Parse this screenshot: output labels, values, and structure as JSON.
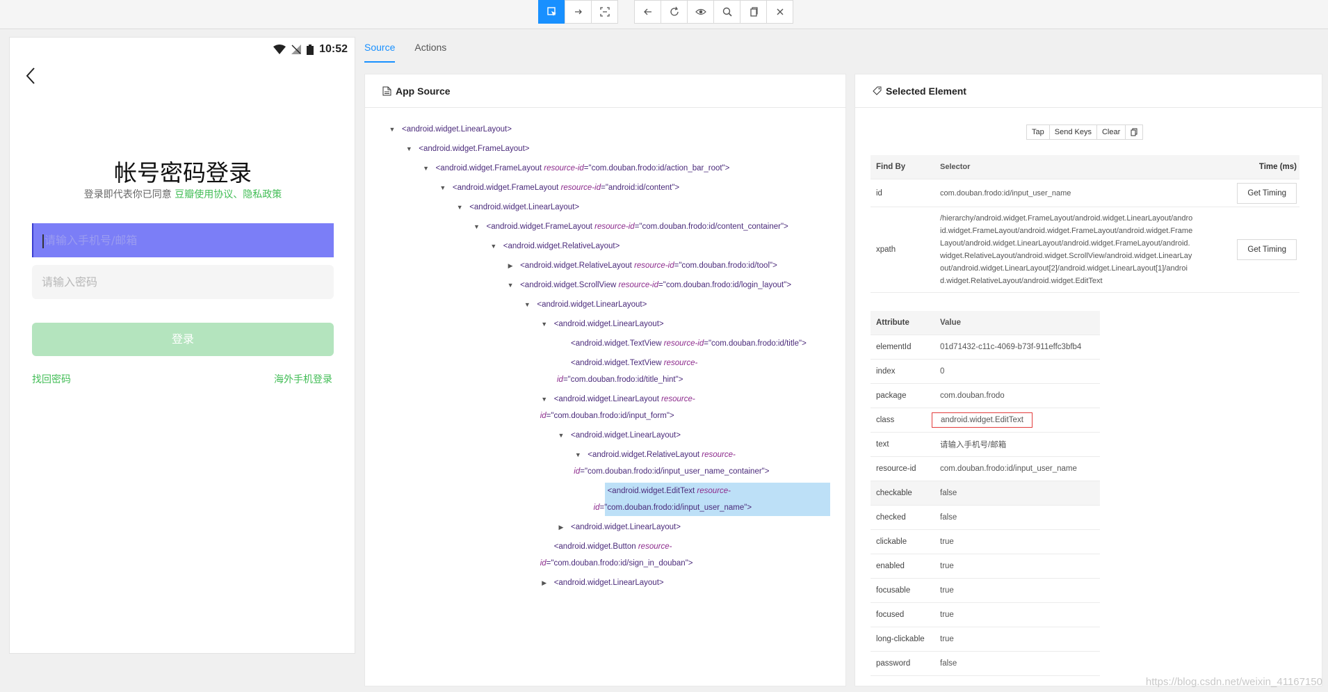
{
  "toolbar": {
    "left_group": [
      {
        "name": "select-element-icon",
        "active": true
      },
      {
        "name": "swipe-icon",
        "active": false
      },
      {
        "name": "tap-coordinates-icon",
        "active": false
      }
    ],
    "right_group": [
      {
        "name": "back-icon"
      },
      {
        "name": "refresh-icon"
      },
      {
        "name": "eye-icon"
      },
      {
        "name": "search-icon"
      },
      {
        "name": "copy-icon"
      },
      {
        "name": "close-icon"
      }
    ]
  },
  "phone": {
    "time": "10:52",
    "title": "帐号密码登录",
    "hint_prefix": "登录即代表你已同意 ",
    "hint_link": "豆瓣使用协议、隐私政策",
    "username_placeholder": "请输入手机号/邮箱",
    "password_placeholder": "请输入密码",
    "login_button": "登录",
    "forgot_password": "找回密码",
    "overseas_login": "海外手机登录"
  },
  "tabs": [
    {
      "label": "Source",
      "active": true
    },
    {
      "label": "Actions",
      "active": false
    }
  ],
  "source_panel": {
    "title": "App Source",
    "nodes": [
      {
        "depth": 0,
        "toggle": "open",
        "tag": "<android.widget.LinearLayout>"
      },
      {
        "depth": 1,
        "toggle": "open",
        "tag": "<android.widget.FrameLayout>"
      },
      {
        "depth": 2,
        "toggle": "open",
        "tag": "<android.widget.FrameLayout ",
        "attr": "resource-id",
        "val": "\"com.douban.frodo:id/action_bar_root\">"
      },
      {
        "depth": 3,
        "toggle": "open",
        "tag": "<android.widget.FrameLayout ",
        "attr": "resource-id",
        "val": "\"android:id/content\">"
      },
      {
        "depth": 4,
        "toggle": "open",
        "tag": "<android.widget.LinearLayout>"
      },
      {
        "depth": 5,
        "toggle": "open",
        "tag": "<android.widget.FrameLayout ",
        "attr": "resource-id",
        "val": "\"com.douban.frodo:id/content_container\">"
      },
      {
        "depth": 6,
        "toggle": "open",
        "tag": "<android.widget.RelativeLayout>"
      },
      {
        "depth": 7,
        "toggle": "closed",
        "tag": "<android.widget.RelativeLayout ",
        "attr": "resource-id",
        "val": "\"com.douban.frodo:id/tool\">"
      },
      {
        "depth": 7,
        "toggle": "open",
        "tag": "<android.widget.ScrollView ",
        "attr": "resource-id",
        "val": "\"com.douban.frodo:id/login_layout\">"
      },
      {
        "depth": 8,
        "toggle": "open",
        "tag": "<android.widget.LinearLayout>"
      },
      {
        "depth": 9,
        "toggle": "open",
        "tag": "<android.widget.LinearLayout>"
      },
      {
        "depth": 10,
        "toggle": "",
        "tag": "<android.widget.TextView ",
        "attr": "resource-id",
        "val": "\"com.douban.frodo:id/title\">"
      },
      {
        "depth": 10,
        "toggle": "",
        "tag": "<android.widget.TextView ",
        "attr": "resource-",
        "line2_attr": "id",
        "line2_val": "\"com.douban.frodo:id/title_hint\">"
      },
      {
        "depth": 9,
        "toggle": "open",
        "tag": "<android.widget.LinearLayout ",
        "attr": "resource-",
        "line2_attr": "id",
        "line2_val": "\"com.douban.frodo:id/input_form\">"
      },
      {
        "depth": 10,
        "toggle": "open",
        "tag": "<android.widget.LinearLayout>"
      },
      {
        "depth": 11,
        "toggle": "open",
        "tag": "<android.widget.RelativeLayout ",
        "attr": "resource-",
        "line2_attr": "id",
        "line2_val": "\"com.douban.frodo:id/input_user_name_container\">"
      },
      {
        "depth": 12,
        "toggle": "",
        "tag": "<android.widget.EditText ",
        "attr": "resource-",
        "line2_attr": "id",
        "line2_val": "\"com.douban.frodo:id/input_user_name\">",
        "selected": true
      },
      {
        "depth": 10,
        "toggle": "closed",
        "tag": "<android.widget.LinearLayout>"
      },
      {
        "depth": 9,
        "toggle": "",
        "tag": "<android.widget.Button ",
        "attr": "resource-",
        "line2_attr": "id",
        "line2_val": "\"com.douban.frodo:id/sign_in_douban\">"
      },
      {
        "depth": 9,
        "toggle": "closed",
        "tag": "<android.widget.LinearLayout>"
      }
    ]
  },
  "selected_panel": {
    "title": "Selected Element",
    "actions": [
      "Tap",
      "Send Keys",
      "Clear"
    ],
    "findby_headers": {
      "find_by": "Find By",
      "selector": "Selector",
      "time": "Time (ms)"
    },
    "findby_rows": [
      {
        "find_by": "id",
        "selector": "com.douban.frodo:id/input_user_name",
        "button": "Get Timing"
      },
      {
        "find_by": "xpath",
        "selector_lines": [
          "/hierarchy/android.widget.FrameLayout/android.widget.LinearLayout/andro",
          "id.widget.FrameLayout/android.widget.FrameLayout/android.widget.Frame",
          "Layout/android.widget.LinearLayout/android.widget.FrameLayout/android.",
          "widget.RelativeLayout/android.widget.ScrollView/android.widget.LinearLay",
          "out/android.widget.LinearLayout[2]/android.widget.LinearLayout[1]/androi",
          "d.widget.RelativeLayout/android.widget.EditText"
        ],
        "button": "Get Timing"
      }
    ],
    "attr_headers": {
      "attribute": "Attribute",
      "value": "Value"
    },
    "attributes": [
      {
        "k": "elementId",
        "v": "01d71432-c11c-4069-b73f-911effc3bfb4"
      },
      {
        "k": "index",
        "v": "0"
      },
      {
        "k": "package",
        "v": "com.douban.frodo"
      },
      {
        "k": "class",
        "v": "android.widget.EditText",
        "boxed": true
      },
      {
        "k": "text",
        "v": "请输入手机号/邮箱"
      },
      {
        "k": "resource-id",
        "v": "com.douban.frodo:id/input_user_name"
      },
      {
        "k": "checkable",
        "v": "false",
        "hl": true
      },
      {
        "k": "checked",
        "v": "false"
      },
      {
        "k": "clickable",
        "v": "true"
      },
      {
        "k": "enabled",
        "v": "true"
      },
      {
        "k": "focusable",
        "v": "true"
      },
      {
        "k": "focused",
        "v": "true"
      },
      {
        "k": "long-clickable",
        "v": "true"
      },
      {
        "k": "password",
        "v": "false"
      }
    ]
  },
  "watermark": "https://blog.csdn.net/weixin_41167150",
  "colors": {
    "accent": "#1890ff",
    "green": "#42bd56",
    "selected_node": "#bde0f7"
  }
}
